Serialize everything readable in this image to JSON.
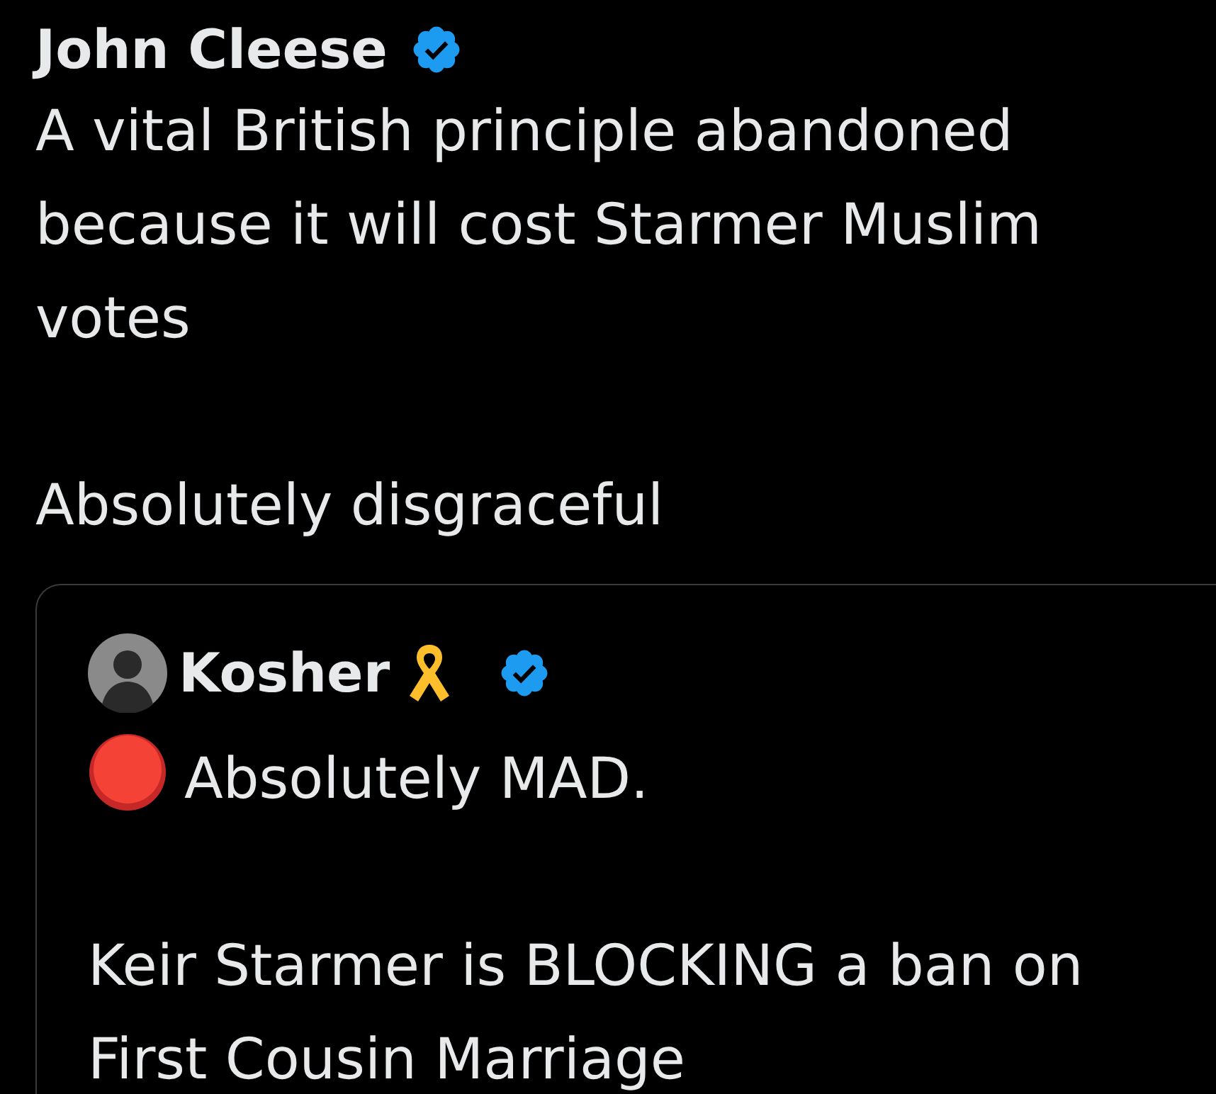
{
  "post": {
    "author": {
      "name": "John Cleese",
      "verified": true
    },
    "paragraphs": [
      "A vital British principle abandoned because it will cost Starmer Muslim votes",
      "Absolutely disgraceful"
    ]
  },
  "quote": {
    "author": {
      "name": "Kosher",
      "ribbon": true,
      "verified": true
    },
    "paragraphs": [
      {
        "kind": "bulleted",
        "text": "Absolutely MAD."
      },
      {
        "kind": "plain",
        "text": "Keir Starmer is BLOCKING a ban on First Cousin Marriage"
      }
    ]
  }
}
